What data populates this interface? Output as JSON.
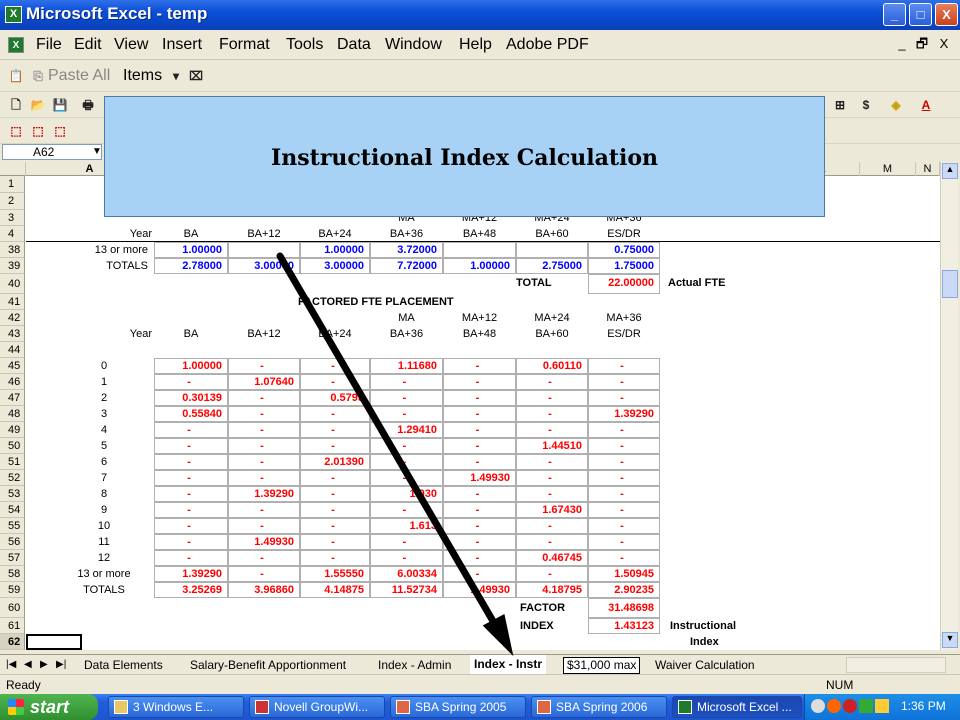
{
  "window": {
    "title": "Microsoft Excel - temp",
    "minimize": "_",
    "restore": "□",
    "close": "X"
  },
  "menu": [
    "File",
    "Edit",
    "View",
    "Insert",
    "Format",
    "Tools",
    "Data",
    "Window",
    "Help",
    "Adobe PDF"
  ],
  "mdi": {
    "minimize": "_",
    "restore": "🗗",
    "close": "X"
  },
  "toolbar_items": {
    "paste_all": "Paste All",
    "items": "Items"
  },
  "namebox": "A62",
  "columns": [
    "A",
    "B",
    "C",
    "D",
    "E",
    "F",
    "G",
    "H",
    "I",
    "J",
    "K",
    "L",
    "M",
    "N"
  ],
  "overlay": {
    "title": "Instructional Index Calculation"
  },
  "rows": [
    "1",
    "2",
    "3",
    "4",
    "38",
    "39",
    "40",
    "41",
    "42",
    "43",
    "44",
    "45",
    "46",
    "47",
    "48",
    "49",
    "50",
    "51",
    "52",
    "53",
    "54",
    "55",
    "56",
    "57",
    "58",
    "59",
    "60",
    "61",
    "62",
    "63"
  ],
  "top_headers": {
    "row3": [
      "MA",
      "MA+12",
      "MA+24",
      "MA+36"
    ],
    "row4": [
      "Year",
      "BA",
      "BA+12",
      "BA+24",
      "BA+36",
      "BA+48",
      "BA+60",
      "ES/DR"
    ]
  },
  "fte_rows": [
    {
      "year": "13 or more",
      "values": [
        "1.00000",
        "",
        "1.00000",
        "3.72000",
        "",
        "",
        "0.75000"
      ]
    },
    {
      "year": "TOTALS",
      "values": [
        "2.78000",
        "3.00000",
        "3.00000",
        "7.72000",
        "1.00000",
        "2.75000",
        "1.75000"
      ]
    }
  ],
  "total_label": "TOTAL",
  "total_value": "22.00000",
  "actual_fte": "Actual FTE",
  "factored_title": "FACTORED FTE PLACEMENT",
  "factored_rows": [
    {
      "year": "0",
      "values": [
        "1.00000",
        "-",
        "-",
        "1.11680",
        "-",
        "0.60110",
        "-"
      ]
    },
    {
      "year": "1",
      "values": [
        "-",
        "1.07640",
        "-",
        "-",
        "-",
        "-",
        "-"
      ]
    },
    {
      "year": "2",
      "values": [
        "0.30139",
        "-",
        "0.5793",
        "-",
        "-",
        "-",
        "-"
      ]
    },
    {
      "year": "3",
      "values": [
        "0.55840",
        "-",
        "-",
        "-",
        "-",
        "-",
        "1.39290"
      ]
    },
    {
      "year": "4",
      "values": [
        "-",
        "-",
        "-",
        "1.29410",
        "-",
        "-",
        "-"
      ]
    },
    {
      "year": "5",
      "values": [
        "-",
        "-",
        "-",
        "-",
        "-",
        "1.44510",
        "-"
      ]
    },
    {
      "year": "6",
      "values": [
        "-",
        "-",
        "2.01390",
        "-",
        "-",
        "-",
        "-"
      ]
    },
    {
      "year": "7",
      "values": [
        "-",
        "-",
        "-",
        "-",
        "1.49930",
        "-",
        "-"
      ]
    },
    {
      "year": "8",
      "values": [
        "-",
        "1.39290",
        "-",
        "1.930",
        "-",
        "-",
        "-"
      ]
    },
    {
      "year": "9",
      "values": [
        "-",
        "-",
        "-",
        "-",
        "-",
        "1.67430",
        "-"
      ]
    },
    {
      "year": "10",
      "values": [
        "-",
        "-",
        "-",
        "1.613",
        "-",
        "-",
        "-"
      ]
    },
    {
      "year": "11",
      "values": [
        "-",
        "1.49930",
        "-",
        "-",
        "-",
        "-",
        "-"
      ]
    },
    {
      "year": "12",
      "values": [
        "-",
        "-",
        "-",
        "-",
        "-",
        "0.46745",
        "-"
      ]
    },
    {
      "year": "13 or more",
      "values": [
        "1.39290",
        "-",
        "1.55550",
        "6.00334",
        "-",
        "-",
        "1.50945"
      ]
    },
    {
      "year": "TOTALS",
      "values": [
        "3.25269",
        "3.96860",
        "4.14875",
        "11.52734",
        "1.49930",
        "4.18795",
        "2.90235"
      ]
    }
  ],
  "factor_label": "FACTOR",
  "factor_value": "31.48698",
  "index_label": "INDEX",
  "index_value": "1.43123",
  "instructional": "Instructional",
  "index_word": "Index",
  "sheet_tabs": [
    "Data Elements",
    "Salary-Benefit Apportionment",
    "Index - Admin",
    "Index - Instr"
  ],
  "sheet_tabs_right": "Waiver Calculation",
  "max_note": "$31,000 max",
  "status": {
    "ready": "Ready",
    "num": "NUM"
  },
  "taskbar": {
    "start": "start",
    "tasks": [
      "3 Windows E...",
      "Novell GroupWi...",
      "SBA Spring 2005",
      "SBA Spring 2006",
      "Microsoft Excel ..."
    ],
    "time": "1:36 PM"
  }
}
